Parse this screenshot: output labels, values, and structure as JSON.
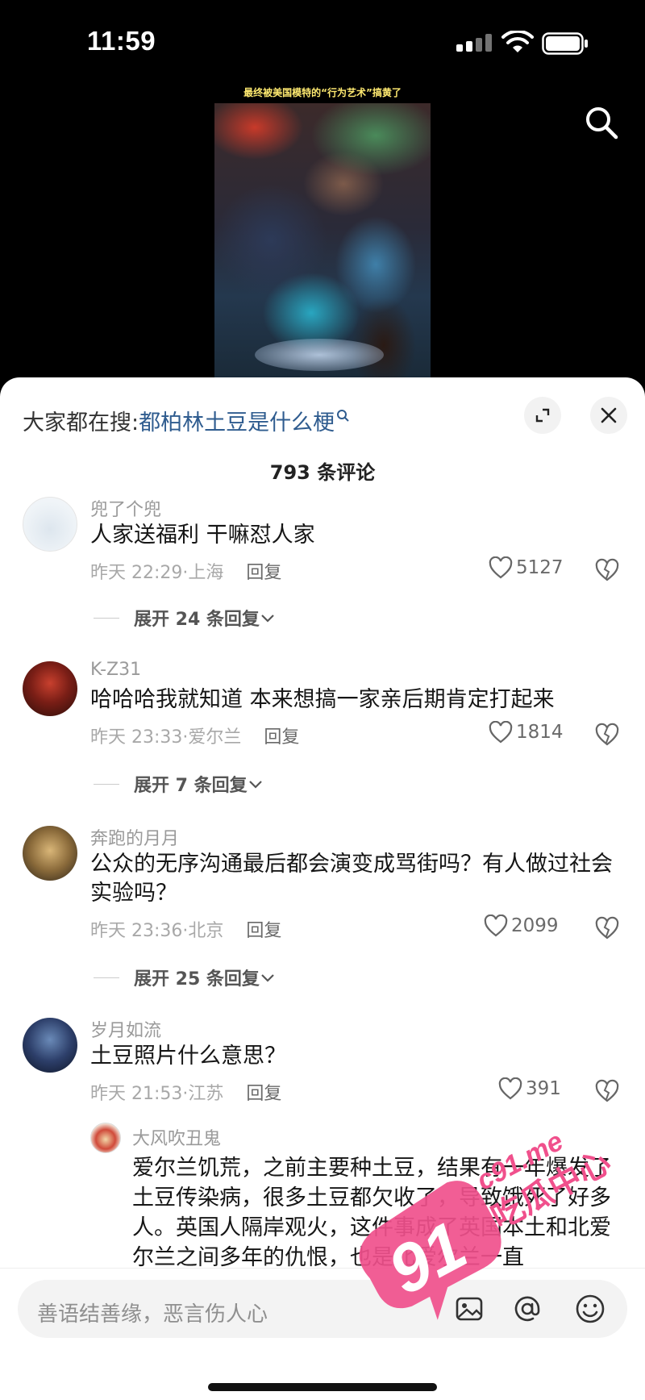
{
  "status_bar": {
    "time": "11:59"
  },
  "video": {
    "caption": "最终被美国模特的“行为艺术”搞黄了"
  },
  "sheet": {
    "search_prefix": "大家都在搜:",
    "search_keyword": "都柏林土豆是什么梗",
    "comment_count_label": "793 条评论"
  },
  "comments": [
    {
      "username": "兜了个兜",
      "content": "人家送福利 干嘛怼人家",
      "time": "昨天 22:29",
      "location": "上海",
      "reply_label": "回复",
      "likes": "5127",
      "expand_label": "展开 24 条回复"
    },
    {
      "username": "K-Z31",
      "content": "哈哈哈我就知道 本来想搞一家亲后期肯定打起来",
      "time": "昨天 23:33",
      "location": "爱尔兰",
      "reply_label": "回复",
      "likes": "1814",
      "expand_label": "展开 7 条回复"
    },
    {
      "username": "奔跑的月月",
      "content": "公众的无序沟通最后都会演变成骂街吗？有人做过社会实验吗？",
      "time": "昨天 23:36",
      "location": "北京",
      "reply_label": "回复",
      "likes": "2099",
      "expand_label": "展开 25 条回复"
    },
    {
      "username": "岁月如流",
      "content": "土豆照片什么意思？",
      "time": "昨天 21:53",
      "location": "江苏",
      "reply_label": "回复",
      "likes": "391"
    }
  ],
  "sub_reply": {
    "username": "大风吹丑鬼",
    "content": "爱尔兰饥荒，之前主要种土豆，结果有一年爆发了土豆传染病，很多土豆都欠收了，导致饿死了好多人。英国人隔岸观火，这件事成了英国本土和北爱尔兰之间多年的仇恨，也是北爱尔兰一直"
  },
  "input": {
    "placeholder": "善语结善缘，恶言伤人心"
  },
  "watermark": {
    "text_a": "91",
    "text_b": "吃瓜中心",
    "text_c": "c91.me"
  },
  "colors": {
    "keyword_blue": "#2f5c8f",
    "watermark_pink": "#f0508c"
  },
  "icons": [
    "search-icon",
    "expand-icon",
    "close-icon",
    "heart-icon",
    "dislike-heart-icon",
    "image-icon",
    "at-icon",
    "emoji-icon",
    "wifi-icon",
    "battery-icon",
    "signal-icon"
  ]
}
